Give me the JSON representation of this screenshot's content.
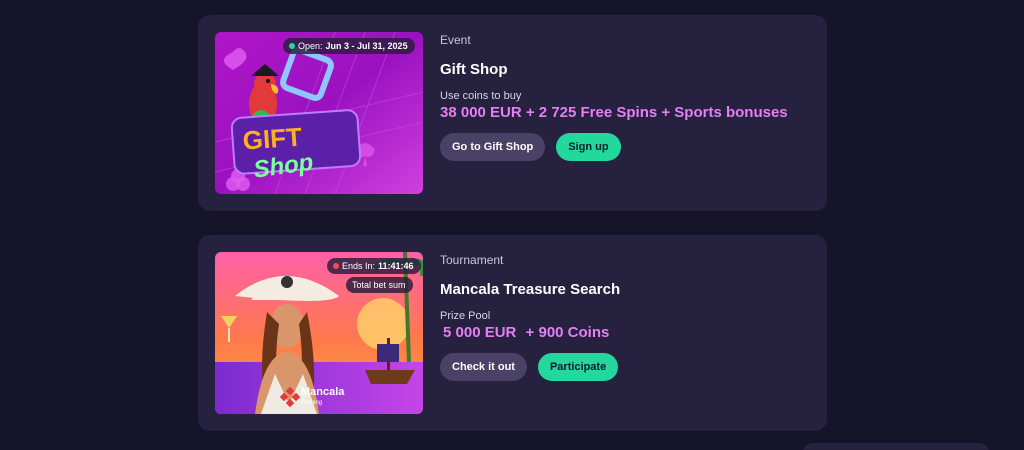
{
  "events": [
    {
      "kind": "Event",
      "title": "Gift Shop",
      "sub_label": "Use coins to buy",
      "prize_parts": [
        "38 000 EUR + 2 725 Free Spins + Sports bonuses"
      ],
      "badge": {
        "prefix": "Open:",
        "value": "Jun 3 - Jul 31, 2025",
        "dot_color": "#22d89d"
      },
      "image_text": [
        "GIFT",
        "Shop"
      ],
      "buttons": {
        "secondary": "Go to Gift Shop",
        "primary": "Sign up"
      }
    },
    {
      "kind": "Tournament",
      "title": "Mancala Treasure Search",
      "sub_label": "Prize Pool",
      "prize_parts": [
        "5 000 EUR",
        "+ 900 Coins"
      ],
      "badge": {
        "prefix": "Ends In:",
        "value": "11:41:46",
        "dot_color": "#f04e5e"
      },
      "badge2": "Total bet sum",
      "brand": {
        "name": "Mancala",
        "sub": "Gaming"
      },
      "buttons": {
        "secondary": "Check it out",
        "primary": "Participate"
      }
    }
  ],
  "colors": {
    "background": "#16142a",
    "card": "#25213e",
    "accent_pink": "#e67ff5",
    "primary_button": "#22d89d",
    "secondary_button": "#4a4266"
  }
}
